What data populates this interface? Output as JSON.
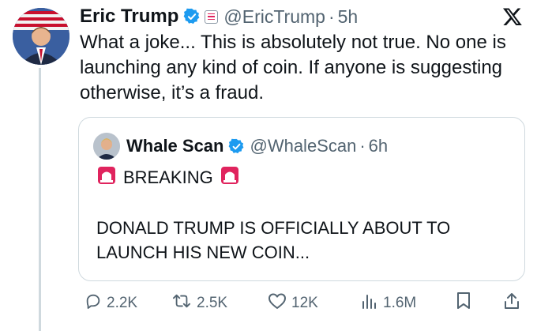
{
  "tweet": {
    "author_name": "Eric Trump",
    "handle": "@EricTrump",
    "separator": "·",
    "time": "5h",
    "text": "What a joke... This is absolutely not true. No one is launching any kind of coin. If anyone is suggesting otherwise, it’s a fraud."
  },
  "quote": {
    "author_name": "Whale Scan",
    "handle": "@WhaleScan",
    "separator": "·",
    "time": "6h",
    "breaking": "BREAKING",
    "body": "DONALD TRUMP IS OFFICIALLY ABOUT TO LAUNCH HIS NEW COIN..."
  },
  "actions": {
    "replies": "2.2K",
    "reposts": "2.5K",
    "likes": "12K",
    "views": "1.6M"
  },
  "colors": {
    "verified_blue": "#1d9bf0",
    "muted_text": "#536471",
    "border": "#cfd9de",
    "siren_red": "#e0245e"
  },
  "icons": [
    "verified-badge-icon",
    "government-badge-icon",
    "x-logo-icon",
    "siren-icon",
    "reply-icon",
    "repost-icon",
    "like-icon",
    "views-icon",
    "bookmark-icon",
    "share-icon"
  ]
}
